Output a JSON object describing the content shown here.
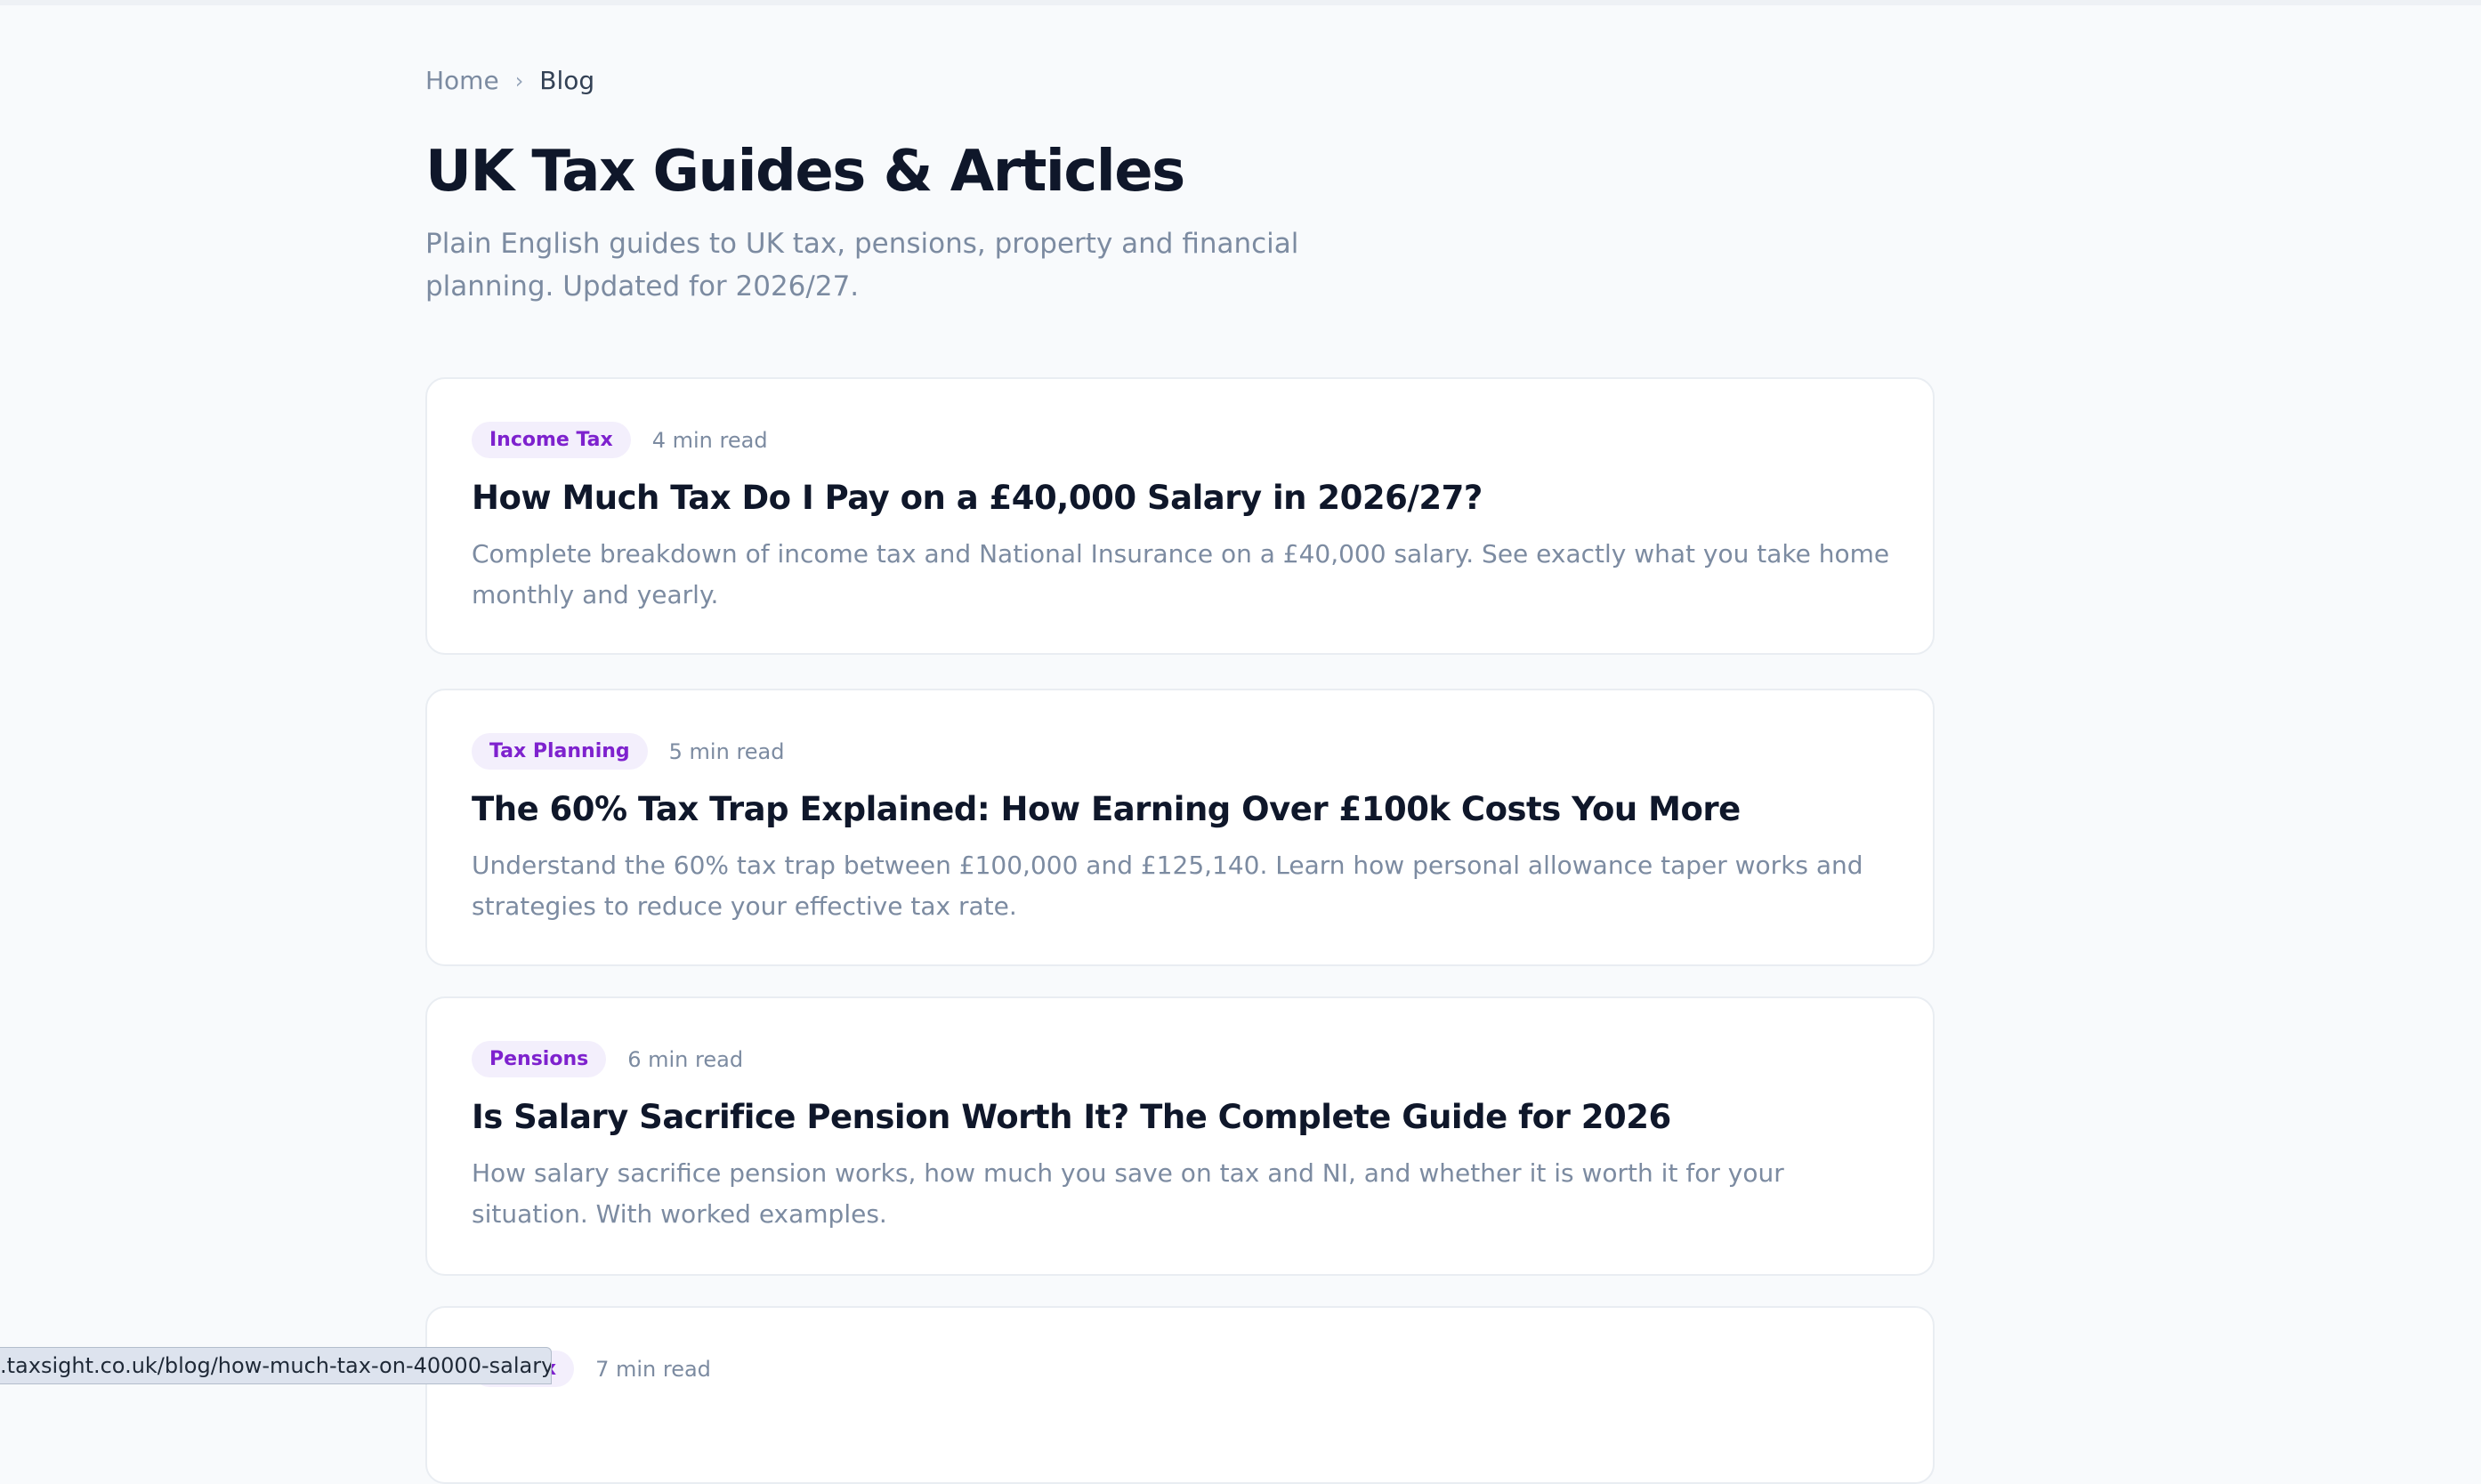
{
  "breadcrumb": {
    "home": "Home",
    "separator": "›",
    "current": "Blog"
  },
  "page": {
    "title": "UK Tax Guides & Articles",
    "subtitle": "Plain English guides to UK tax, pensions, property and financial planning. Updated for 2026/27."
  },
  "articles": [
    {
      "category": "Income Tax",
      "read_time": "4 min read",
      "title": "How Much Tax Do I Pay on a £40,000 Salary in 2026/27?",
      "excerpt": "Complete breakdown of income tax and National Insurance on a £40,000 salary. See exactly what you take home monthly and yearly."
    },
    {
      "category": "Tax Planning",
      "read_time": "5 min read",
      "title": "The 60% Tax Trap Explained: How Earning Over £100k Costs You More",
      "excerpt": "Understand the 60% tax trap between £100,000 and £125,140. Learn how personal allowance taper works and strategies to reduce your effective tax rate."
    },
    {
      "category": "Pensions",
      "read_time": "6 min read",
      "title": "Is Salary Sacrifice Pension Worth It? The Complete Guide for 2026",
      "excerpt": "How salary sacrifice pension works, how much you save on tax and NI, and whether it is worth it for your situation. With worked examples."
    },
    {
      "category": "ss Tax",
      "read_time": "7 min read",
      "title": "",
      "excerpt": ""
    }
  ],
  "status_bar": {
    "url": ".taxsight.co.uk/blog/how-much-tax-on-40000-salary"
  },
  "colors": {
    "accent": "#7e22ce",
    "badge_bg": "#f3effc",
    "muted_text": "#7c8ba1",
    "heading": "#0f172a",
    "background": "#f8fafc"
  }
}
